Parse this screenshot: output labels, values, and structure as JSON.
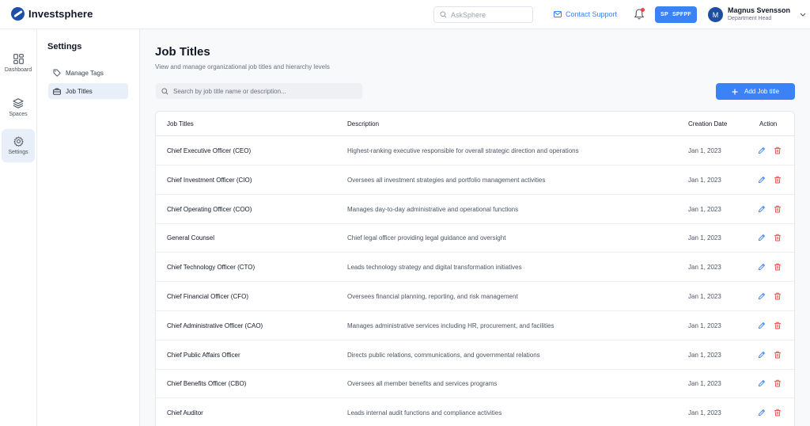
{
  "app": {
    "name": "Investsphere"
  },
  "header": {
    "ask_placeholder": "AskSphere",
    "contact_label": "Contact Support",
    "space_badge_abbr": "SP",
    "space_badge_name": "SPFPF",
    "user": {
      "initial": "M",
      "name": "Magnus Svensson",
      "role": "Department Head"
    }
  },
  "rail": {
    "items": [
      {
        "label": "Dashboard",
        "icon": "grid-icon"
      },
      {
        "label": "Spaces",
        "icon": "layers-icon"
      },
      {
        "label": "Settings",
        "icon": "gear-icon"
      }
    ]
  },
  "settings": {
    "title": "Settings",
    "items": [
      {
        "label": "Manage Tags",
        "icon": "tag-icon"
      },
      {
        "label": "Job Titles",
        "icon": "briefcase-icon"
      }
    ]
  },
  "main": {
    "title": "Job Titles",
    "subtitle": "View and manage organizational job titles and hierarchy levels",
    "search_placeholder": "Search by job title name or description...",
    "add_label": "Add Job title",
    "columns": [
      "Job Titles",
      "Description",
      "Creation Date",
      "Action"
    ],
    "rows": [
      {
        "title": "Chief Executive Officer (CEO)",
        "desc": "Highest-ranking executive responsible for overall strategic direction and operations",
        "date": "Jan 1, 2023"
      },
      {
        "title": "Chief Investment Officer (CIO)",
        "desc": "Oversees all investment strategies and portfolio management activities",
        "date": "Jan 1, 2023"
      },
      {
        "title": "Chief Operating Officer (COO)",
        "desc": "Manages day-to-day administrative and operational functions",
        "date": "Jan 1, 2023"
      },
      {
        "title": "General Counsel",
        "desc": "Chief legal officer providing legal guidance and oversight",
        "date": "Jan 1, 2023"
      },
      {
        "title": "Chief Technology Officer (CTO)",
        "desc": "Leads technology strategy and digital transformation initiatives",
        "date": "Jan 1, 2023"
      },
      {
        "title": "Chief Financial Officer (CFO)",
        "desc": "Oversees financial planning, reporting, and risk management",
        "date": "Jan 1, 2023"
      },
      {
        "title": "Chief Administrative Officer (CAO)",
        "desc": "Manages administrative services including HR, procurement, and facilities",
        "date": "Jan 1, 2023"
      },
      {
        "title": "Chief Public Affairs Officer",
        "desc": "Directs public relations, communications, and governmental relations",
        "date": "Jan 1, 2023"
      },
      {
        "title": "Chief Benefits Officer (CBO)",
        "desc": "Oversees all member benefits and services programs",
        "date": "Jan 1, 2023"
      },
      {
        "title": "Chief Auditor",
        "desc": "Leads internal audit functions and compliance activities",
        "date": "Jan 1, 2023"
      }
    ]
  },
  "colors": {
    "accent": "#3b82f6",
    "brand": "#1d4fa8",
    "danger": "#ef4444",
    "active_bg": "#e8eff9"
  }
}
